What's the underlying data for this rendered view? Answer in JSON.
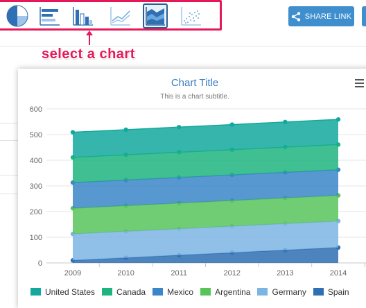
{
  "toolbar": {
    "chart_types": [
      {
        "icon": "pie-chart-icon",
        "active": false
      },
      {
        "icon": "bar-chart-icon",
        "active": false
      },
      {
        "icon": "column-chart-icon",
        "active": false
      },
      {
        "icon": "line-chart-icon",
        "active": false
      },
      {
        "icon": "area-chart-icon",
        "active": true
      },
      {
        "icon": "scatter-chart-icon",
        "active": false
      }
    ],
    "share_label": "SHARE LINK",
    "share_icon": "share-icon"
  },
  "annotation": {
    "text": "select a chart",
    "color": "#e5195a"
  },
  "chart": {
    "title": "Chart Title",
    "subtitle": "This is a chart subtitle."
  },
  "chart_data": {
    "type": "area",
    "stacked": true,
    "categories": [
      "2009",
      "2010",
      "2011",
      "2012",
      "2013",
      "2014"
    ],
    "ylim": [
      0,
      600
    ],
    "yticks": [
      0,
      100,
      200,
      300,
      400,
      500,
      600
    ],
    "grid": true,
    "legend": "bottom",
    "series": [
      {
        "name": "United States",
        "color": "#13a89e",
        "values": [
          98,
          98,
          98,
          98,
          98,
          98
        ]
      },
      {
        "name": "Canada",
        "color": "#1fb47f",
        "values": [
          98,
          98,
          98,
          98,
          98,
          98
        ]
      },
      {
        "name": "Mexico",
        "color": "#3a86c8",
        "values": [
          100,
          100,
          100,
          100,
          100,
          100
        ]
      },
      {
        "name": "Argentina",
        "color": "#57c45a",
        "values": [
          100,
          100,
          100,
          100,
          100,
          100
        ]
      },
      {
        "name": "Germany",
        "color": "#7cb5e3",
        "values": [
          103,
          103,
          103,
          103,
          103,
          103
        ]
      },
      {
        "name": "Spain",
        "color": "#2f6fb3",
        "values": [
          10,
          20,
          30,
          40,
          50,
          60
        ]
      }
    ]
  }
}
